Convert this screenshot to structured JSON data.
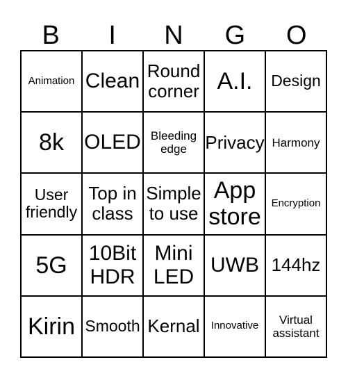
{
  "card": {
    "title": "BINGO card",
    "header_letters": [
      "B",
      "I",
      "N",
      "G",
      "O"
    ],
    "colors": {
      "background": "#ffffff",
      "text": "#000000",
      "grid_line": "#000000"
    },
    "grid": {
      "columns": 5,
      "rows": 5,
      "rows_data": [
        [
          {
            "text": "Animation",
            "size": "xs"
          },
          {
            "text": "Clean",
            "size": "xl"
          },
          {
            "text": "Round\ncorner",
            "size": "lg"
          },
          {
            "text": "A.I.",
            "size": "xxl"
          },
          {
            "text": "Design",
            "size": "md"
          }
        ],
        [
          {
            "text": "8k",
            "size": "xxl"
          },
          {
            "text": "OLED",
            "size": "xl"
          },
          {
            "text": "Bleeding\nedge",
            "size": "sm"
          },
          {
            "text": "Privacy",
            "size": "lg"
          },
          {
            "text": "Harmony",
            "size": "sm"
          }
        ],
        [
          {
            "text": "User\nfriendly",
            "size": "md"
          },
          {
            "text": "Top in\nclass",
            "size": "lg"
          },
          {
            "text": "Simple\nto use",
            "size": "lg"
          },
          {
            "text": "App\nstore",
            "size": "xxl"
          },
          {
            "text": "Encryption",
            "size": "xs"
          }
        ],
        [
          {
            "text": "5G",
            "size": "xxl"
          },
          {
            "text": "10Bit\nHDR",
            "size": "xl"
          },
          {
            "text": "Mini\nLED",
            "size": "xl"
          },
          {
            "text": "UWB",
            "size": "xl"
          },
          {
            "text": "144hz",
            "size": "lg"
          }
        ],
        [
          {
            "text": "Kirin",
            "size": "xxl"
          },
          {
            "text": "Smooth",
            "size": "md"
          },
          {
            "text": "Kernal",
            "size": "lg"
          },
          {
            "text": "Innovative",
            "size": "xs"
          },
          {
            "text": "Virtual\nassistant",
            "size": "sm"
          }
        ]
      ]
    }
  }
}
